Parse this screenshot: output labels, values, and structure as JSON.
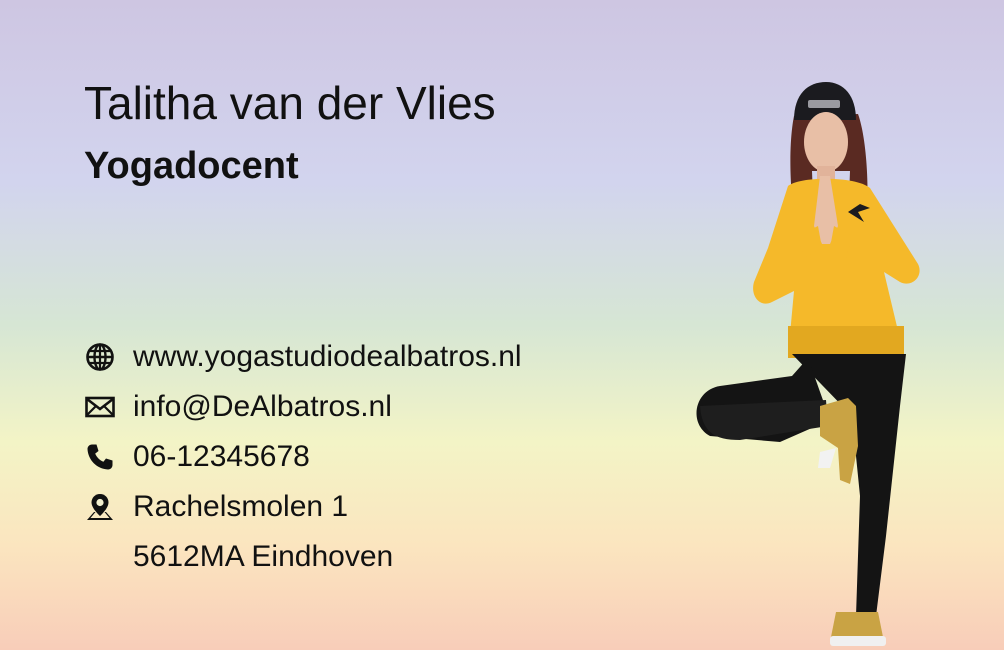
{
  "card": {
    "name": "Talitha van der Vlies",
    "title": "Yogadocent"
  },
  "contact": {
    "website": {
      "icon": "globe-icon",
      "text": "www.yogastudiodealbatros.nl"
    },
    "email": {
      "icon": "envelope-icon",
      "text": "info@DeAlbatros.nl"
    },
    "phone": {
      "icon": "phone-icon",
      "text": "06-12345678"
    },
    "address": {
      "icon": "map-pin-icon",
      "line1": "Rachelsmolen 1",
      "line2": "5612MA Eindhoven"
    }
  },
  "colors": {
    "text": "#111111",
    "sweater": "#f5b92a",
    "leggings": "#141414",
    "shoes": "#c9a344",
    "hair": "#5a2a22",
    "skin": "#e8bfa6"
  }
}
